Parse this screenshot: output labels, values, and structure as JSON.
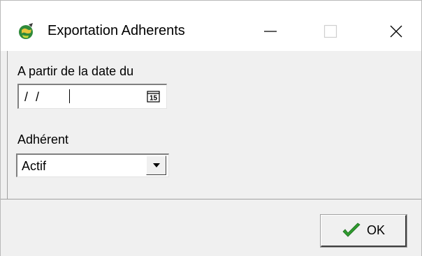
{
  "window": {
    "title": "Exportation Adherents",
    "icon": "app-globe-icon"
  },
  "titlebar_buttons": {
    "minimize": "minimize-icon",
    "maximize": "maximize-icon",
    "close": "close-icon"
  },
  "form": {
    "date_label": "A partir de la date du",
    "date_value": "/ /",
    "calendar_icon_text": "15",
    "adherent_label": "Adhérent",
    "adherent_value": "Actif"
  },
  "footer": {
    "ok_label": "OK"
  },
  "colors": {
    "ok_check": "#2e9b2e",
    "background": "#f0f0f0",
    "titlebar": "#ffffff"
  }
}
